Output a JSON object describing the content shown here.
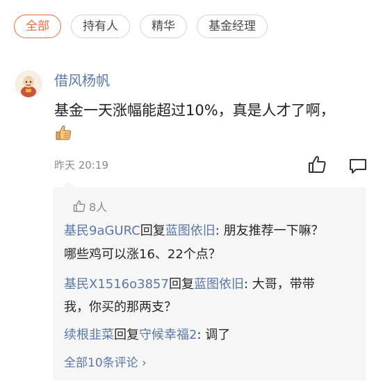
{
  "chips": [
    {
      "label": "全部",
      "active": true
    },
    {
      "label": "持有人",
      "active": false
    },
    {
      "label": "精华",
      "active": false
    },
    {
      "label": "基金经理",
      "active": false
    }
  ],
  "comment": {
    "username": "借风杨帆",
    "text": "基金一天涨幅能超过10%，真是人才了啊，",
    "emoji": "thumbs-up-emoji",
    "timestamp": "昨天 20:19"
  },
  "replies_panel": {
    "likes": "8人",
    "replies": [
      {
        "author": "基民9aGURC",
        "action": "回复",
        "target": "蓝图依旧",
        "colon": ":",
        "text_line1": " 朋友推荐一下嘛？",
        "text_line2": "哪些鸡可以涨16、22个点？"
      },
      {
        "author": "基民X1516o3857",
        "action": "回复",
        "target": "蓝图依旧",
        "colon": ":",
        "text_line1": " 大哥，带带",
        "text_line2": "我，你买的那两支？"
      },
      {
        "author": "续根韭菜",
        "action": "回复",
        "target": "守候幸福2",
        "colon": ":",
        "text_line1": " 调了"
      }
    ],
    "view_all": "全部10条评论 ›"
  },
  "colors": {
    "accent": "#f06a3b",
    "link": "#5a78a8",
    "muted": "#8a8a8a",
    "panel_bg": "#f6f6f6"
  }
}
